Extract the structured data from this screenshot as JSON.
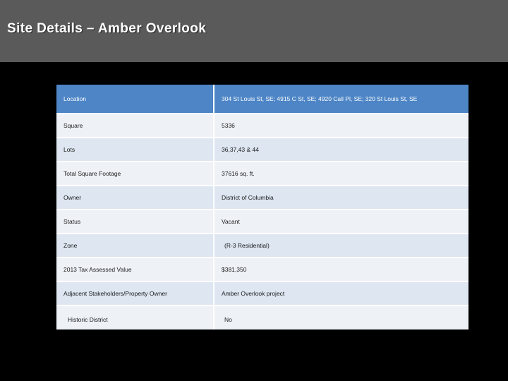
{
  "slide": {
    "title": "Site Details – Amber Overlook",
    "background_color": "#000000",
    "title_band_color": "#5a5a5a",
    "accent_color": "#4d85c6"
  },
  "table": {
    "rows": [
      {
        "label": "Location",
        "value": "304 St Louis St, SE; 4915 C St, SE; 4920 Call Pl, SE; 320 St Louis St, SE"
      },
      {
        "label": "Square",
        "value": "5336"
      },
      {
        "label": "Lots",
        "value": "36,37,43 & 44"
      },
      {
        "label": "Total Square Footage",
        "value": "37616 sq. ft."
      },
      {
        "label": "Owner",
        "value": "District of Columbia"
      },
      {
        "label": "Status",
        "value": "Vacant"
      },
      {
        "label": "Zone",
        "value": "(R-3 Residential)"
      },
      {
        "label": "2013 Tax Assessed Value",
        "value": "$381,350"
      },
      {
        "label": "Adjacent Stakeholders/Property Owner",
        "value": "Amber Overlook project"
      },
      {
        "label": "Historic District",
        "value": "No"
      }
    ]
  }
}
